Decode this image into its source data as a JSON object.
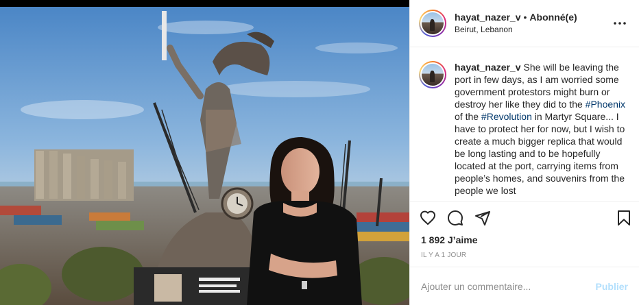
{
  "post": {
    "username": "hayat_nazer_v",
    "follow_separator": "•",
    "follow_state": "Abonné(e)",
    "location": "Beirut, Lebanon"
  },
  "caption": {
    "username": "hayat_nazer_v",
    "text_1": "She will be leaving the port in few days, as I am worried some government protestors might burn or destroy her like they did to the ",
    "hashtag_1": "#Phoenix",
    "text_2": " of the ",
    "hashtag_2": "#Revolution",
    "text_3": " in Martyr Square... I have to protect her for now, but I wish to create a much bigger replica that would be long lasting and to be hopefully located at the port, carrying items from people’s homes, and souvenirs from the people we lost"
  },
  "stats": {
    "likes": "1 892 J’aime",
    "time": "IL Y A 1 JOUR"
  },
  "comment": {
    "placeholder": "Ajouter un commentaire...",
    "publish_label": "Publier"
  },
  "icons": {
    "more": "more-horizontal-icon",
    "like": "heart-icon",
    "comment": "comment-bubble-icon",
    "share": "paper-plane-icon",
    "save": "bookmark-icon"
  },
  "colors": {
    "hashtag": "#00376b",
    "publish_disabled": "#b2dffc",
    "secondary_text": "#8e8e8e"
  }
}
